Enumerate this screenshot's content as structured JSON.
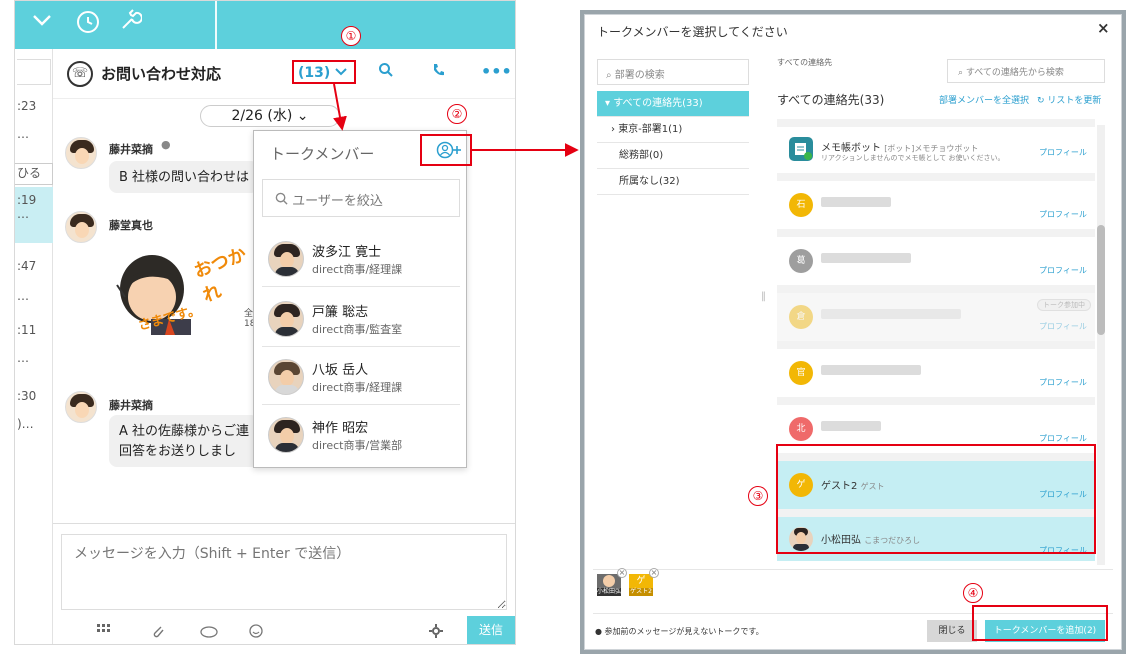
{
  "chat": {
    "room_title": "お問い合わせ対応",
    "member_count": "(13)",
    "date_label": "2/26 (水)",
    "left_strip": [
      ":23",
      "…",
      "ひる",
      ":19",
      "…",
      ":47",
      "…",
      ":11",
      "…",
      ":30",
      ")…"
    ],
    "messages": [
      {
        "sender": "藤井菜摘",
        "text": "B 社様の問い合わせは"
      },
      {
        "sender": "藤堂真也",
        "text": ""
      },
      {
        "sender": "藤井菜摘",
        "text_line1": "A 社の佐藤様からご連",
        "text_line2": "回答をお送りしまし"
      }
    ],
    "sticker_text": {
      "line1": "おつかれ",
      "line2": "さまです。"
    },
    "sticker_side": {
      "line1": "全",
      "line2": "18"
    },
    "input_placeholder": "メッセージを入力（Shift + Enter で送信）",
    "send_label": "送信"
  },
  "popup": {
    "title": "トークメンバー",
    "search_placeholder": "ユーザーを絞込",
    "members": [
      {
        "name": "波多江 寛士",
        "dept": "direct商事/経理課"
      },
      {
        "name": "戸簾 聡志",
        "dept": "direct商事/監査室"
      },
      {
        "name": "八坂 岳人",
        "dept": "direct商事/経理課"
      },
      {
        "name": "神作 昭宏",
        "dept": "direct商事/営業部"
      }
    ]
  },
  "annotations": [
    "①",
    "②",
    "③",
    "④"
  ],
  "dialog": {
    "title": "トークメンバーを選択してください",
    "close": "×",
    "dept_search": "部署の検索",
    "depts": [
      "すべての連絡先(33)",
      "東京-部署1(1)",
      "総務部(0)",
      "所属なし(32)"
    ],
    "contacts_label": "すべての連絡先",
    "contacts_search": "すべての連絡先から検索",
    "contacts_heading": "すべての連絡先(33)",
    "select_all": "部署メンバーを全選択",
    "refresh": "リストを更新",
    "profile": "プロフィール",
    "contacts": [
      {
        "name": "メモ帳ボット",
        "tag": "[ボット]メモチョウボット",
        "sub": "リアクションしませんのでメモ帳として お使いください。"
      },
      {
        "initial": "石",
        "color": "#f2b705"
      },
      {
        "initial": "葛",
        "color": "#9e9e9e"
      },
      {
        "initial": "倉",
        "color": "#f2b705",
        "badge": "トーク参加中"
      },
      {
        "initial": "官",
        "color": "#f2b705"
      },
      {
        "initial": "北",
        "color": "#ef6a6a"
      },
      {
        "initial": "ゲ",
        "color": "#f2b705",
        "name": "ゲスト2",
        "sub": "ゲスト"
      },
      {
        "name": "小松田弘",
        "sub": "こまつだひろし"
      }
    ],
    "chips": [
      "小松田弘",
      "ゲスト2"
    ],
    "note": "参加前のメッセージが見えないトークです。",
    "close_button": "閉じる",
    "add_button": "トークメンバーを追加(2)"
  },
  "colors": {
    "accent": "#5dd0dc",
    "link": "#2b9fcf",
    "annotation": "#e50012"
  }
}
